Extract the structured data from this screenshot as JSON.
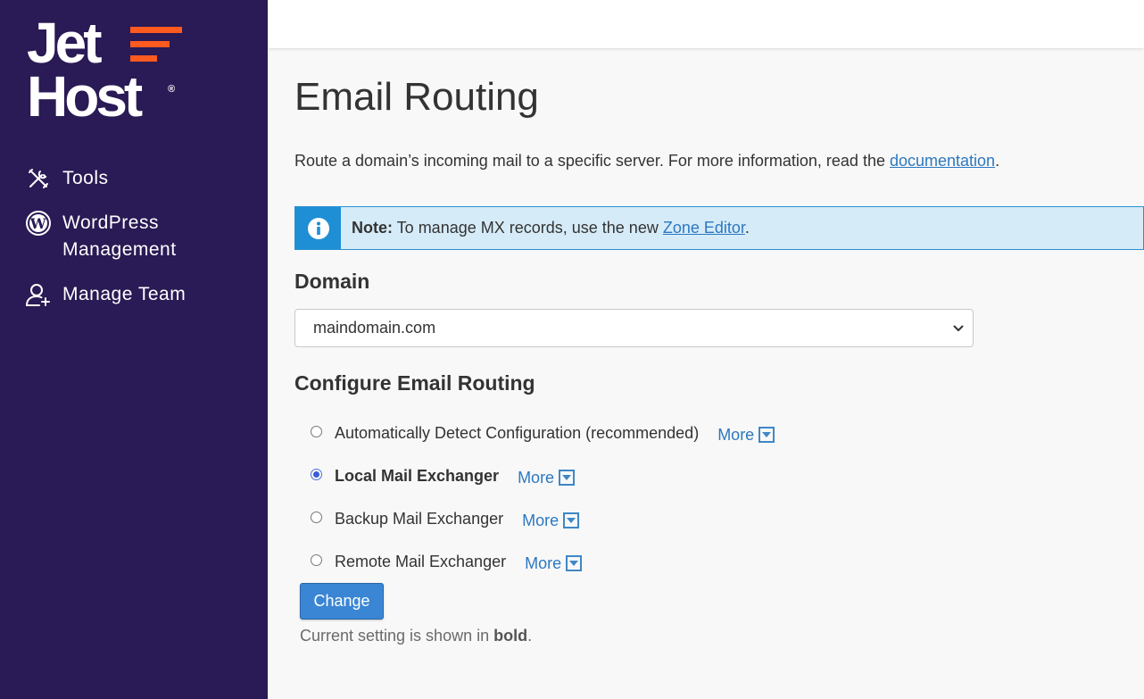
{
  "brand": {
    "line1": "Jet",
    "line2": "Host",
    "registered": "®",
    "accent_color": "#ff5a1f",
    "sidebar_color": "#2a1a55"
  },
  "sidebar": {
    "items": [
      {
        "label": "Tools",
        "icon": "tools-icon"
      },
      {
        "label_line1": "WordPress",
        "label_line2": "Management",
        "icon": "wordpress-icon"
      },
      {
        "label": "Manage Team",
        "icon": "add-user-icon"
      }
    ]
  },
  "page": {
    "title": "Email Routing",
    "description_prefix": "Route a domain’s incoming mail to a specific server. For more information, read the ",
    "description_link": "documentation",
    "description_suffix": "."
  },
  "note": {
    "label": "Note:",
    "text_prefix": " To manage MX records, use the new ",
    "link": "Zone Editor",
    "text_suffix": ".",
    "icon": "info-icon"
  },
  "domain": {
    "label": "Domain",
    "selected": "maindomain.com"
  },
  "routing": {
    "label": "Configure Email Routing",
    "more_label": "More",
    "options": [
      {
        "label": "Automatically Detect Configuration (recommended)",
        "checked": false
      },
      {
        "label": "Local Mail Exchanger",
        "checked": true
      },
      {
        "label": "Backup Mail Exchanger",
        "checked": false
      },
      {
        "label": "Remote Mail Exchanger",
        "checked": false
      }
    ]
  },
  "actions": {
    "change_label": "Change"
  },
  "hint": {
    "prefix": "Current setting is shown in ",
    "bold": "bold",
    "suffix": "."
  }
}
